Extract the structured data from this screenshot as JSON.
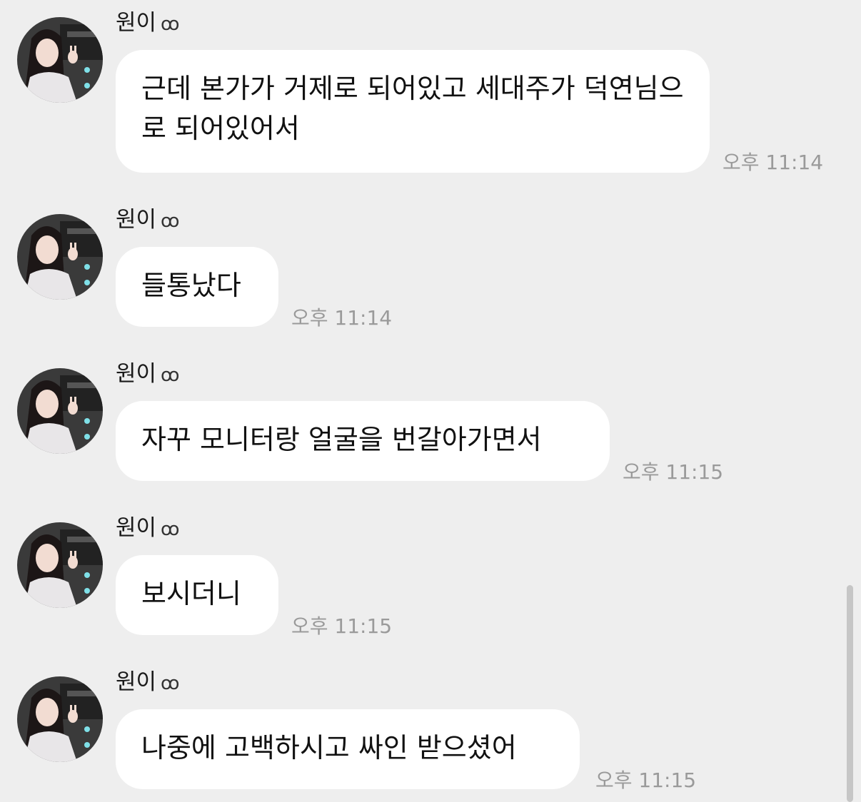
{
  "sender_name": "원이",
  "sender_icon": "ꝏ",
  "messages": [
    {
      "text": "근데 본가가 거제로 되어있고 세대주가 덕연님으로 되어있어서",
      "time": "오후 11:14"
    },
    {
      "text": "들통났다",
      "time": "오후 11:14"
    },
    {
      "text": "자꾸 모니터랑 얼굴을 번갈아가면서",
      "time": "오후 11:15"
    },
    {
      "text": "보시더니",
      "time": "오후 11:15"
    },
    {
      "text": "나중에 고백하시고 싸인 받으셨어",
      "time": "오후 11:15"
    }
  ],
  "colors": {
    "background": "#eeeeee",
    "bubble": "#ffffff",
    "time": "#9a9a9a"
  }
}
